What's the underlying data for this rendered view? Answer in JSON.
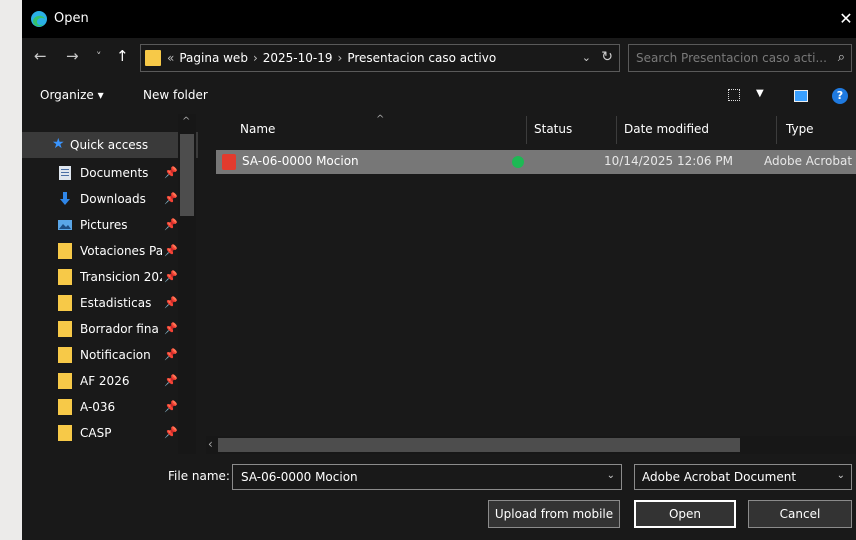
{
  "window": {
    "title": "Open",
    "close_glyph": "✕"
  },
  "nav": {
    "back": "←",
    "forward": "→",
    "recent": "˅",
    "up": "↑"
  },
  "address": {
    "overflow": "«",
    "crumbs": [
      "Pagina web",
      "2025-10-19",
      "Presentacion caso activo"
    ],
    "separator": "›"
  },
  "search": {
    "placeholder": "Search Presentacion caso acti..."
  },
  "toolbar": {
    "organize_label": "Organize ▾",
    "new_folder_label": "New folder"
  },
  "sidebar": {
    "quick_access": "Quick access",
    "items": [
      {
        "label": "Documents",
        "icon": "document-icon"
      },
      {
        "label": "Downloads",
        "icon": "download-icon"
      },
      {
        "label": "Pictures",
        "icon": "pictures-icon"
      },
      {
        "label": "Votaciones Pa",
        "icon": "folder-icon"
      },
      {
        "label": "Transicion 202",
        "icon": "folder-icon"
      },
      {
        "label": "Estadisticas",
        "icon": "folder-icon"
      },
      {
        "label": "Borrador fina",
        "icon": "folder-icon"
      },
      {
        "label": "Notificacion ",
        "icon": "folder-icon"
      },
      {
        "label": "AF 2026",
        "icon": "folder-icon"
      },
      {
        "label": "A-036",
        "icon": "folder-icon"
      },
      {
        "label": "CASP",
        "icon": "folder-icon"
      }
    ]
  },
  "columns": {
    "name": "Name",
    "status": "Status",
    "date": "Date modified",
    "type": "Type"
  },
  "files": [
    {
      "name": "SA-06-0000 Mocion",
      "date": "10/14/2025 12:06 PM",
      "type": "Adobe Acrobat"
    }
  ],
  "bottom": {
    "filename_label": "File name:",
    "filename_value": "SA-06-0000 Mocion",
    "filetype_value": "Adobe Acrobat Document",
    "upload_label": "Upload from mobile",
    "open_label": "Open",
    "cancel_label": "Cancel"
  },
  "colors": {
    "background": "#191919",
    "accent": "#3a95ff",
    "folder": "#f7c948",
    "selected_row": "#777777",
    "status_ok": "#1db954"
  }
}
